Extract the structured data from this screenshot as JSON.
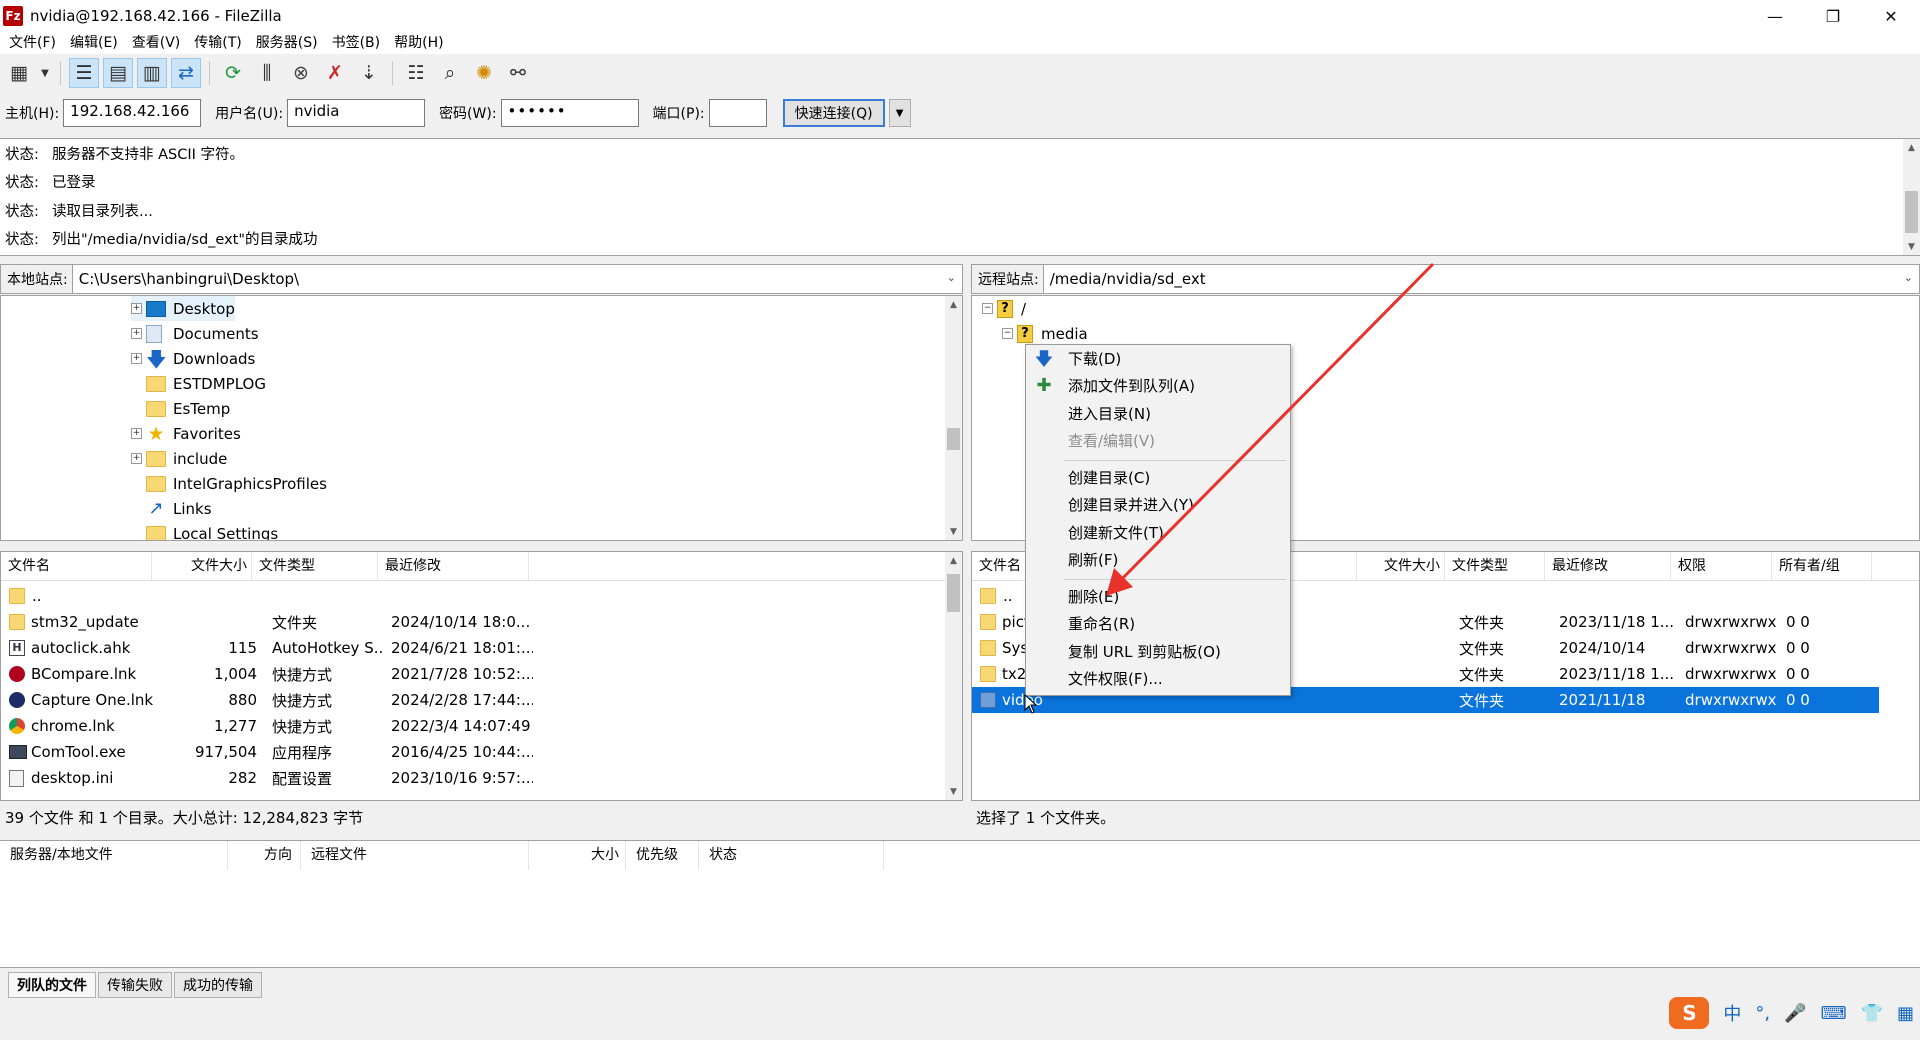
{
  "window": {
    "title": "nvidia@192.168.42.166 - FileZilla",
    "app_icon": "Fz",
    "controls": [
      "—",
      "❐",
      "✕"
    ]
  },
  "menu": [
    "文件(F)",
    "编辑(E)",
    "查看(V)",
    "传输(T)",
    "服务器(S)",
    "书签(B)",
    "帮助(H)"
  ],
  "quickconnect": {
    "host_label": "主机(H):",
    "host_value": "192.168.42.166",
    "user_label": "用户名(U):",
    "user_value": "nvidia",
    "pass_label": "密码(W):",
    "pass_value": "••••••",
    "port_label": "端口(P):",
    "port_value": "",
    "connect_label": "快速连接(Q)"
  },
  "log": [
    {
      "label": "状态:",
      "text": "服务器不支持非 ASCII 字符。"
    },
    {
      "label": "状态:",
      "text": "已登录"
    },
    {
      "label": "状态:",
      "text": "读取目录列表..."
    },
    {
      "label": "状态:",
      "text": "列出\"/media/nvidia/sd_ext\"的目录成功"
    }
  ],
  "local": {
    "site_label": "本地站点:",
    "path": "C:\\Users\\hanbingrui\\Desktop\\",
    "tree": [
      {
        "name": "Desktop",
        "expander": "+",
        "icon": "folder-blue"
      },
      {
        "name": "Documents",
        "expander": "+",
        "icon": "doc"
      },
      {
        "name": "Downloads",
        "expander": "+",
        "icon": "download"
      },
      {
        "name": "ESTDMPLOG",
        "expander": "",
        "icon": "folder"
      },
      {
        "name": "EsTemp",
        "expander": "",
        "icon": "folder"
      },
      {
        "name": "Favorites",
        "expander": "+",
        "icon": "star"
      },
      {
        "name": "include",
        "expander": "+",
        "icon": "folder"
      },
      {
        "name": "IntelGraphicsProfiles",
        "expander": "",
        "icon": "folder"
      },
      {
        "name": "Links",
        "expander": "",
        "icon": "link"
      },
      {
        "name": "Local Settings",
        "expander": "",
        "icon": "folder"
      }
    ],
    "columns": [
      "文件名",
      "文件大小",
      "文件类型",
      "最近修改"
    ],
    "files": [
      {
        "name": "..",
        "size": "",
        "type": "",
        "modified": "",
        "icon": "folder"
      },
      {
        "name": "stm32_update",
        "size": "",
        "type": "文件夹",
        "modified": "2024/10/14 18:0...",
        "icon": "folder"
      },
      {
        "name": "autoclick.ahk",
        "size": "115",
        "type": "AutoHotkey S...",
        "modified": "2024/6/21 18:01:...",
        "icon": "ahk"
      },
      {
        "name": "BCompare.lnk",
        "size": "1,004",
        "type": "快捷方式",
        "modified": "2021/7/28 10:52:...",
        "icon": "bc"
      },
      {
        "name": "Capture One.lnk",
        "size": "880",
        "type": "快捷方式",
        "modified": "2024/2/28 17:44:...",
        "icon": "c1"
      },
      {
        "name": "chrome.lnk",
        "size": "1,277",
        "type": "快捷方式",
        "modified": "2022/3/4 14:07:49",
        "icon": "chrome"
      },
      {
        "name": "ComTool.exe",
        "size": "917,504",
        "type": "应用程序",
        "modified": "2016/4/25 10:44:...",
        "icon": "exe"
      },
      {
        "name": "desktop.ini",
        "size": "282",
        "type": "配置设置",
        "modified": "2023/10/16 9:57:...",
        "icon": "ini"
      }
    ],
    "status": "39 个文件 和 1 个目录。大小总计: 12,284,823 字节"
  },
  "remote": {
    "site_label": "远程站点:",
    "path": "/media/nvidia/sd_ext",
    "tree": [
      {
        "name": "/",
        "expander": "−"
      },
      {
        "name": "media",
        "expander": "−"
      }
    ],
    "columns": [
      "文件名",
      "文件大小",
      "文件类型",
      "最近修改",
      "权限",
      "所有者/组"
    ],
    "files": [
      {
        "name": "..",
        "size": "",
        "type": "",
        "modified": "",
        "perm": "",
        "owner": ""
      },
      {
        "name": "pict",
        "size": "",
        "type": "文件夹",
        "modified": "2023/11/18 1...",
        "perm": "drwxrwxrwx",
        "owner": "0 0"
      },
      {
        "name": "Sys",
        "size": "",
        "type": "文件夹",
        "modified": "2024/10/14",
        "perm": "drwxrwxrwx",
        "owner": "0 0"
      },
      {
        "name": "tx2_",
        "size": "",
        "type": "文件夹",
        "modified": "2023/11/18 1...",
        "perm": "drwxrwxrwx",
        "owner": "0 0"
      },
      {
        "name": "video",
        "size": "",
        "type": "文件夹",
        "modified": "2021/11/18",
        "perm": "drwxrwxrwx",
        "owner": "0 0"
      }
    ],
    "status": "选择了 1 个文件夹。"
  },
  "context_menu": {
    "items": [
      {
        "label": "下载(D)",
        "icon": "download-arrow",
        "disabled": false
      },
      {
        "label": "添加文件到队列(A)",
        "icon": "queue-add",
        "disabled": false
      },
      {
        "label": "进入目录(N)",
        "disabled": false
      },
      {
        "label": "查看/编辑(V)",
        "disabled": true
      },
      {
        "label": "创建目录(C)",
        "disabled": false
      },
      {
        "label": "创建目录并进入(Y)",
        "disabled": false
      },
      {
        "label": "创建新文件(T)",
        "disabled": false
      },
      {
        "label": "刷新(F)",
        "disabled": false
      },
      {
        "label": "删除(E)",
        "disabled": false
      },
      {
        "label": "重命名(R)",
        "disabled": false
      },
      {
        "label": "复制 URL 到剪贴板(O)",
        "disabled": false
      },
      {
        "label": "文件权限(F)...",
        "disabled": false
      }
    ]
  },
  "queue": {
    "columns": [
      "服务器/本地文件",
      "方向",
      "远程文件",
      "大小",
      "优先级",
      "状态"
    ],
    "tabs": [
      "列队的文件",
      "传输失败",
      "成功的传输"
    ]
  },
  "ime": {
    "logo": "S",
    "lang": "中"
  },
  "colors": {
    "selection": "#0a74dc",
    "annotation": "#e8322c"
  }
}
